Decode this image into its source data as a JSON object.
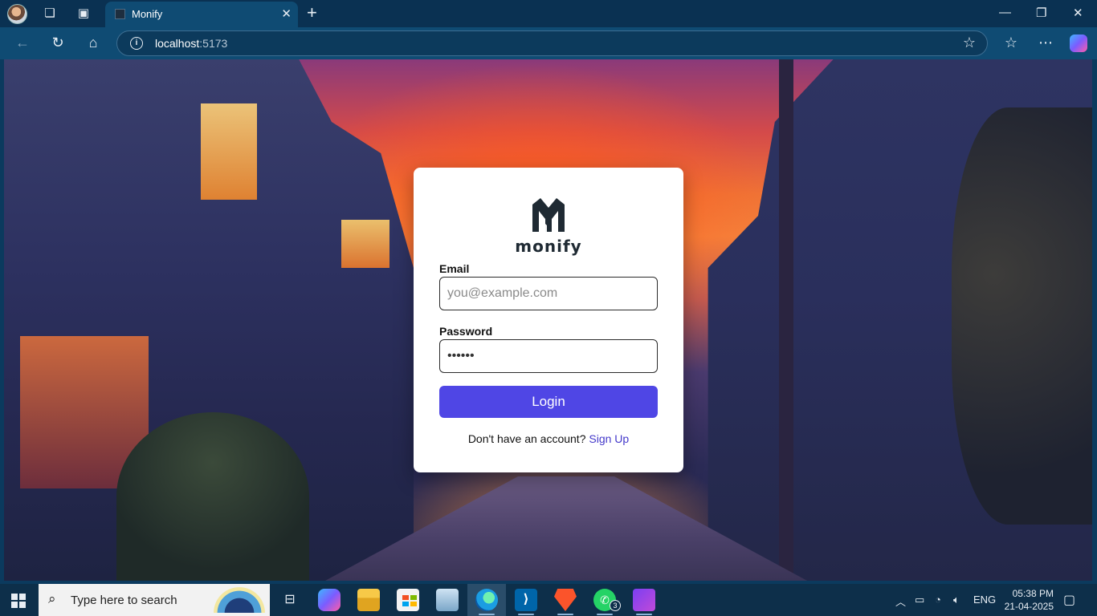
{
  "browser": {
    "tab_title": "Monify",
    "url_host": "localhost",
    "url_port": ":5173",
    "icons": [
      "profile-avatar",
      "workspaces-icon",
      "tab-actions-icon",
      "close-icon",
      "new-tab-icon",
      "minimize-icon",
      "maximize-icon",
      "window-close-icon",
      "back-icon",
      "refresh-icon",
      "home-icon",
      "info-icon",
      "favorite-star-icon",
      "favorites-icon",
      "more-icon",
      "copilot-icon"
    ]
  },
  "login": {
    "brand": "monify",
    "email_label": "Email",
    "email_placeholder": "you@example.com",
    "email_value": "",
    "password_label": "Password",
    "password_value": "123456",
    "login_label": "Login",
    "signup_prompt": "Don't have an account?",
    "signup_link": "Sign Up",
    "colors": {
      "primary": "#4f46e5",
      "link": "#4338ca",
      "card": "#ffffff"
    }
  },
  "taskbar": {
    "search_placeholder": "Type here to search",
    "language": "ENG",
    "time": "05:38 PM",
    "date": "21-04-2025",
    "whatsapp_badge": "3",
    "apps": [
      "task-view",
      "copilot",
      "file-explorer",
      "microsoft-store",
      "photos",
      "edge",
      "vscode",
      "brave",
      "whatsapp",
      "clipchamp"
    ]
  }
}
